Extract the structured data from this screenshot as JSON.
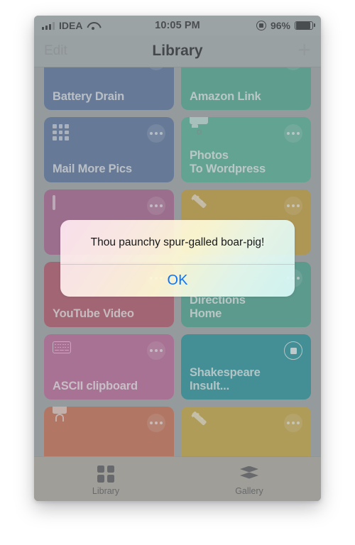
{
  "status_bar": {
    "signal_icon": "cellular-signal-icon",
    "carrier": "IDEA",
    "wifi_icon": "wifi-icon",
    "time": "10:05 PM",
    "rotation_lock_icon": "rotation-lock-icon",
    "battery_percent": "96%",
    "battery_icon": "battery-icon"
  },
  "nav_bar": {
    "edit_label": "Edit",
    "title": "Library",
    "add_label": "+"
  },
  "cards": [
    {
      "title": "Battery Drain",
      "icon": "none",
      "color": "#4a6a9c",
      "action": "ellipsis"
    },
    {
      "title": "Amazon Link",
      "icon": "none",
      "color": "#3ea68a",
      "action": "ellipsis"
    },
    {
      "title": "Mail More Pics",
      "icon": "grid-icon",
      "color": "#4a6a9c",
      "action": "ellipsis"
    },
    {
      "title": "Photos\nTo Wordpress",
      "icon": "camera-icon",
      "color": "#46b092",
      "action": "ellipsis"
    },
    {
      "title": "",
      "icon": "square-icon",
      "color": "#a8558a",
      "action": "ellipsis"
    },
    {
      "title": "",
      "icon": "wand-icon",
      "color": "#c79a28",
      "action": "ellipsis"
    },
    {
      "title": "YouTube Video",
      "icon": "none",
      "color": "#b0455c",
      "action": "ellipsis"
    },
    {
      "title": "Directions\nHome",
      "icon": "none",
      "color": "#38a088",
      "action": "ellipsis"
    },
    {
      "title": "ASCII clipboard",
      "icon": "keyboard-icon",
      "color": "#bc5c95",
      "action": "ellipsis"
    },
    {
      "title": "Shakespeare\nInsult...",
      "icon": "none",
      "color": "#0e8e96",
      "action": "stop"
    },
    {
      "title": "",
      "icon": "lock-icon",
      "color": "#cc6442",
      "action": "ellipsis"
    },
    {
      "title": "",
      "icon": "wand-icon",
      "color": "#c9a430",
      "action": "ellipsis"
    }
  ],
  "alert": {
    "message": "Thou paunchy spur-galled boar-pig!",
    "ok_label": "OK"
  },
  "tab_bar": {
    "tabs": [
      {
        "label": "Library",
        "icon": "grid-tab-icon"
      },
      {
        "label": "Gallery",
        "icon": "layers-tab-icon"
      }
    ]
  },
  "colors": {
    "accent_blue": "#0a74ff",
    "status_bar_bg": "#a8b0b1",
    "nav_bar_bg": "#a4acad",
    "tab_bar_bg": "#aea79e"
  }
}
